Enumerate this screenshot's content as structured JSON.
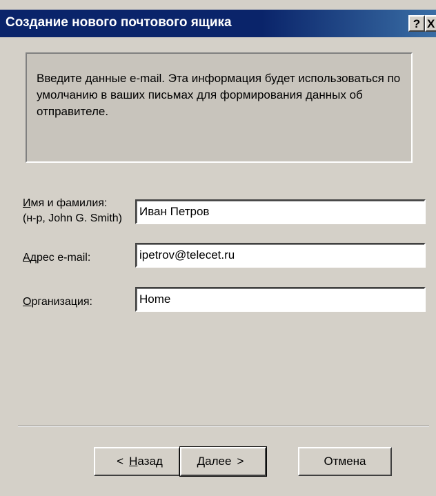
{
  "window": {
    "title": "Создание нового почтового ящика",
    "help_glyph": "?",
    "close_glyph": "X"
  },
  "info": {
    "text_line1": "Введите данные e-mail. Эта информация будет использоваться по",
    "text_line2": "умолчанию в ваших письмах для формирования данных об",
    "text_line3": "отправителе."
  },
  "form": {
    "name_label_accel": "И",
    "name_label_rest": "мя и фамилия:",
    "name_hint": "(н-р, John G. Smith)",
    "name_value": "Иван Петров",
    "email_label_accel": "А",
    "email_label_rest": "дрес e-mail:",
    "email_value": "ipetrov@telecet.ru",
    "org_label_accel": "О",
    "org_label_rest": "рганизация:",
    "org_value": "Home"
  },
  "buttons": {
    "back_arrow": "<",
    "back_accel": "Н",
    "back_rest": "азад",
    "next_accel": "Д",
    "next_rest": "алее",
    "next_arrow": ">",
    "cancel": "Отмена"
  }
}
